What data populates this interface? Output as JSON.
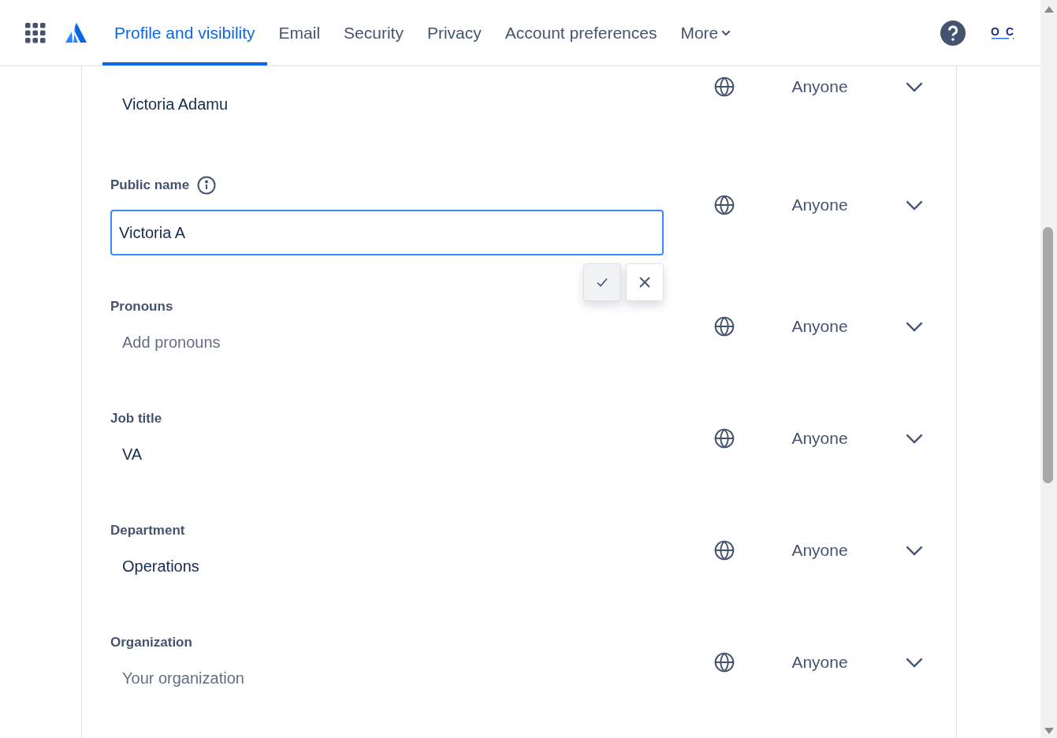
{
  "nav": {
    "tabs": [
      {
        "label": "Profile and visibility",
        "selected": true
      },
      {
        "label": "Email",
        "selected": false
      },
      {
        "label": "Security",
        "selected": false
      },
      {
        "label": "Privacy",
        "selected": false
      },
      {
        "label": "Account preferences",
        "selected": false
      }
    ],
    "more": "More",
    "logo": {
      "initials": "O C"
    }
  },
  "fields": [
    {
      "value": "Victoria Adamu",
      "editing": false,
      "visibility": "Anyone"
    },
    {
      "label": "Public name",
      "info": true,
      "value": "Victoria A",
      "editing": true,
      "visibility": "Anyone"
    },
    {
      "label": "Pronouns",
      "placeholder": "Add pronouns",
      "editing": false,
      "visibility": "Anyone"
    },
    {
      "label": "Job title",
      "value": "VA",
      "editing": false,
      "visibility": "Anyone"
    },
    {
      "label": "Department",
      "value": "Operations",
      "editing": false,
      "visibility": "Anyone"
    },
    {
      "label": "Organization",
      "placeholder": "Your organization",
      "editing": false,
      "visibility": "Anyone"
    }
  ]
}
